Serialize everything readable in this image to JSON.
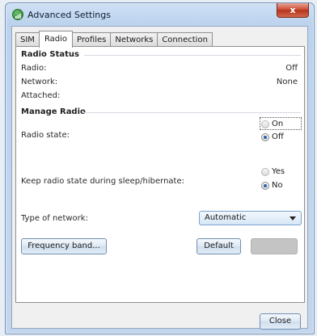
{
  "window": {
    "title": "Advanced Settings",
    "close_glyph": "x"
  },
  "tabs": [
    "SIM",
    "Radio",
    "Profiles",
    "Networks",
    "Connection"
  ],
  "active_tab": "Radio",
  "radio_status": {
    "title": "Radio Status",
    "rows": [
      {
        "label": "Radio:",
        "value": "Off"
      },
      {
        "label": "Network:",
        "value": "None"
      },
      {
        "label": "Attached:",
        "value": ""
      }
    ]
  },
  "manage_radio": {
    "title": "Manage Radio",
    "radio_state": {
      "label": "Radio state:",
      "options": [
        "On",
        "Off"
      ],
      "selected": "Off"
    },
    "keep_state": {
      "label": "Keep radio state during sleep/hibernate:",
      "options": [
        "Yes",
        "No"
      ],
      "selected": "No"
    },
    "network_type": {
      "label": "Type of network:",
      "value": "Automatic"
    }
  },
  "buttons": {
    "frequency_band": "Frequency band...",
    "default": "Default",
    "apply": "",
    "close": "Close"
  },
  "icons": {
    "app": "signal-bars-icon",
    "close": "close-icon"
  }
}
